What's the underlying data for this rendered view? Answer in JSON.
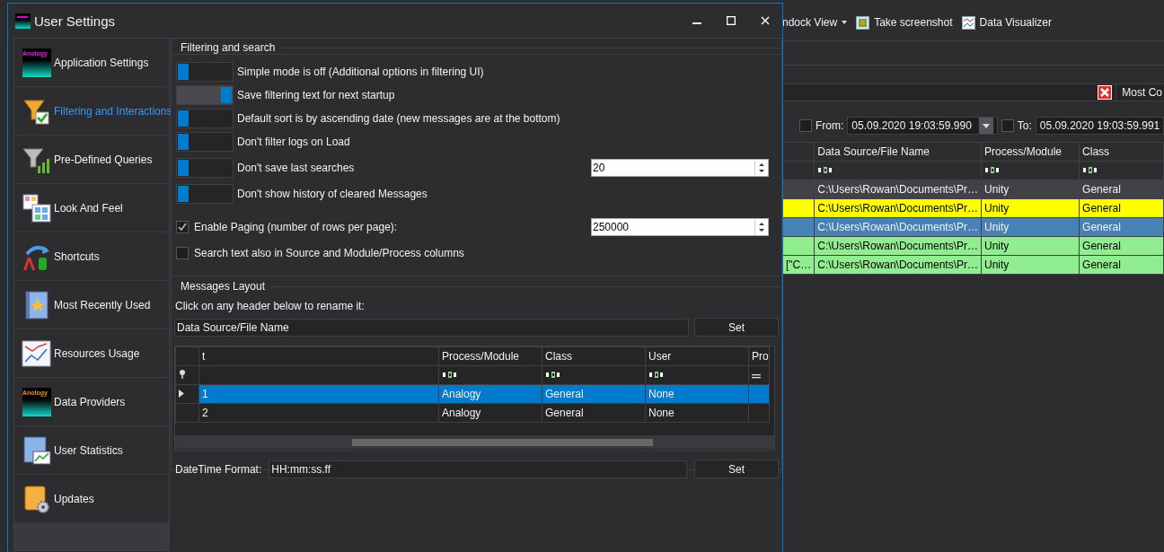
{
  "background_app": {
    "toolbar": [
      {
        "label": "ndock View",
        "kind": "dropdown"
      },
      {
        "label": "Take screenshot",
        "kind": "picture"
      },
      {
        "label": "Data Visualizer",
        "kind": "chart"
      }
    ],
    "search_row": {
      "button": "Most Co"
    },
    "date_filter": {
      "from_checked": false,
      "from_label": "From:",
      "from_value": "05.09.2020 19:03:59.990",
      "to_checked": false,
      "to_label": "To:",
      "to_value": "05.09.2020 19:03:59.991"
    },
    "grid": {
      "columns": [
        "Data Source/File Name",
        "Process/Module",
        "Class"
      ],
      "rows": [
        {
          "color": "#424246",
          "cells": [
            "C:\\Users\\Rowan\\Documents\\Pr…",
            "Unity",
            "General"
          ]
        },
        {
          "color": "#ffff00",
          "cells": [
            "C:\\Users\\Rowan\\Documents\\Pr…",
            "Unity",
            "General"
          ]
        },
        {
          "color": "#4682b4",
          "cells": [
            "C:\\Users\\Rowan\\Documents\\Pr…",
            "Unity",
            "General"
          ]
        },
        {
          "color": "#90ee90",
          "cells": [
            "C:\\Users\\Rowan\\Documents\\Pr…",
            "Unity",
            "General"
          ]
        },
        {
          "color": "#90ee90",
          "column_1": "[\"C…",
          "cells": [
            "C:\\Users\\Rowan\\Documents\\Pr…",
            "Unity",
            "General"
          ]
        }
      ]
    }
  },
  "window": {
    "title": "User Settings"
  },
  "sidebar": {
    "items": [
      {
        "label": "Application Settings",
        "kind": "logo",
        "logo_text": "Anology",
        "selected": false
      },
      {
        "label": "Filtering and Interactions",
        "kind": "filter",
        "selected": true
      },
      {
        "label": "Pre-Defined Queries",
        "kind": "queries",
        "selected": false
      },
      {
        "label": "Look And Feel",
        "kind": "look",
        "selected": false
      },
      {
        "label": "Shortcuts",
        "kind": "shortcuts",
        "selected": false
      },
      {
        "label": "Most Recently Used",
        "kind": "recent",
        "selected": false
      },
      {
        "label": "Resources Usage",
        "kind": "resources",
        "selected": false
      },
      {
        "label": "Data Providers",
        "kind": "logo",
        "logo_text": "Anology",
        "selected": false
      },
      {
        "label": "User Statistics",
        "kind": "statistics",
        "selected": false
      },
      {
        "label": "Updates",
        "kind": "updates",
        "selected": false
      }
    ]
  },
  "filtering": {
    "title": "Filtering and search",
    "options": [
      {
        "kind": "toggle",
        "on": false,
        "label": "Simple mode is off (Additional options in filtering UI)"
      },
      {
        "kind": "toggle",
        "on": true,
        "label": "Save filtering text for next startup"
      },
      {
        "kind": "toggle",
        "on": false,
        "label": "Default sort is by ascending date (new messages are at the bottom)"
      },
      {
        "kind": "toggle",
        "on": false,
        "label": "Don't filter logs on Load"
      },
      {
        "kind": "toggle",
        "on": false,
        "label": "Don't save last searches",
        "value": "20"
      },
      {
        "kind": "toggle",
        "on": false,
        "label": "Don't show history of cleared Messages"
      },
      {
        "kind": "checkbox",
        "checked": true,
        "label": "Enable Paging (number of rows per page):",
        "value": "250000"
      },
      {
        "kind": "checkbox",
        "checked": false,
        "label": "Search text also in Source and Module/Process columns"
      }
    ]
  },
  "messages_layout": {
    "title": "Messages Layout",
    "instruction": "Click on any header below to rename it:",
    "rename_value": "Data Source/File Name",
    "set_button": "Set",
    "grid": {
      "columns": [
        "t",
        "Process/Module",
        "Class",
        "User",
        "Pro"
      ],
      "rows": [
        {
          "selected": true,
          "cells": [
            "1",
            "Analogy",
            "General",
            "None"
          ]
        },
        {
          "selected": false,
          "cells": [
            "2",
            "Analogy",
            "General",
            "None"
          ]
        }
      ]
    },
    "datetime_label": "DateTime Format:",
    "datetime_value": "HH:mm:ss.ff",
    "datetime_button": "Set"
  }
}
